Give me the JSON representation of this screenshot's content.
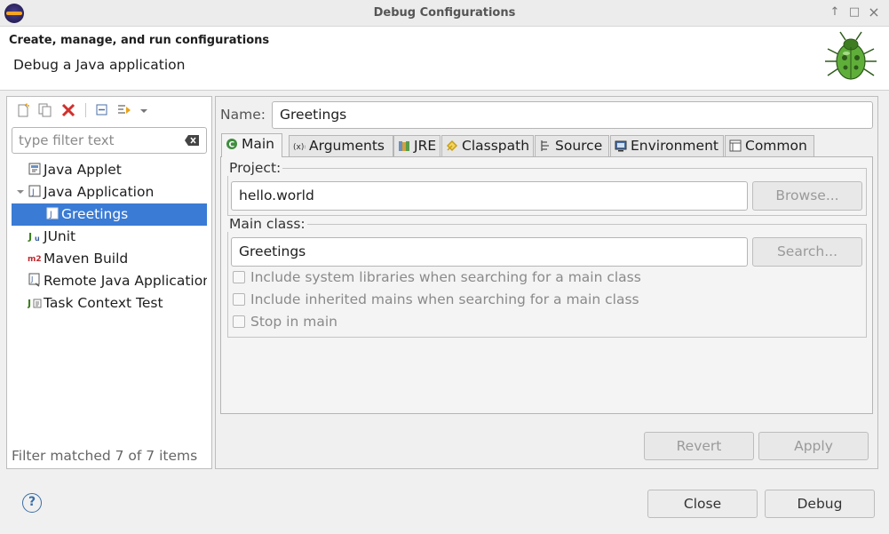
{
  "window": {
    "title": "Debug Configurations",
    "buttons": [
      "↑",
      "□",
      "×"
    ]
  },
  "banner": {
    "title": "Create, manage, and run configurations",
    "subtitle": "Debug a Java application"
  },
  "left": {
    "filter_placeholder": "type filter text",
    "tree": [
      {
        "label": "Java Applet",
        "icon": "java-applet-icon",
        "indent": 0
      },
      {
        "label": "Java Application",
        "icon": "java-application-icon",
        "indent": 0,
        "expanded": true
      },
      {
        "label": "Greetings",
        "icon": "java-config-icon",
        "indent": 1,
        "selected": true
      },
      {
        "label": "JUnit",
        "icon": "junit-icon",
        "indent": 0
      },
      {
        "label": "Maven Build",
        "icon": "maven-icon",
        "indent": 0
      },
      {
        "label": "Remote Java Application",
        "icon": "remote-java-icon",
        "indent": 0
      },
      {
        "label": "Task Context Test",
        "icon": "task-context-icon",
        "indent": 0
      }
    ],
    "status": "Filter matched 7 of 7 items"
  },
  "right": {
    "name_label": "Name:",
    "name_value": "Greetings",
    "tabs": [
      {
        "label": "Main",
        "icon": "main-tab-icon"
      },
      {
        "label": "Arguments",
        "icon": "arguments-tab-icon"
      },
      {
        "label": "JRE",
        "icon": "jre-tab-icon"
      },
      {
        "label": "Classpath",
        "icon": "classpath-tab-icon"
      },
      {
        "label": "Source",
        "icon": "source-tab-icon"
      },
      {
        "label": "Environment",
        "icon": "environment-tab-icon"
      },
      {
        "label": "Common",
        "icon": "common-tab-icon"
      }
    ],
    "project": {
      "label": "Project:",
      "value": "hello.world",
      "button": "Browse..."
    },
    "main_class": {
      "label": "Main class:",
      "value": "Greetings",
      "button": "Search..."
    },
    "checkboxes": [
      {
        "label": "Include system libraries when searching for a main class",
        "checked": false
      },
      {
        "label": "Include inherited mains when searching for a main class",
        "checked": false
      },
      {
        "label": "Stop in main",
        "checked": false
      }
    ],
    "revert": "Revert",
    "apply": "Apply"
  },
  "footer": {
    "help": "?",
    "close": "Close",
    "debug": "Debug"
  }
}
